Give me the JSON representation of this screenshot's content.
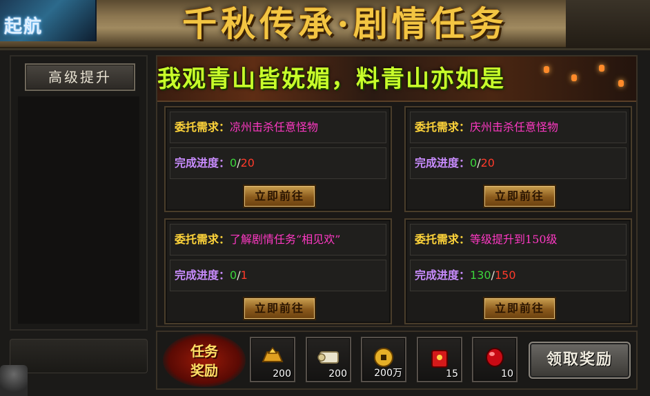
{
  "header": {
    "logo_text": "起航",
    "title": "千秋传承·剧情任务"
  },
  "sidebar": {
    "tab_label": "高级提升"
  },
  "banner": {
    "poem": "我观青山皆妩媚，料青山亦如是"
  },
  "labels": {
    "requirement": "委托需求：",
    "progress": "完成进度：",
    "go_button": "立即前往",
    "progress_sep": "/"
  },
  "tasks": [
    {
      "requirement": "凉州击杀任意怪物",
      "current": "0",
      "max": "20"
    },
    {
      "requirement": "庆州击杀任意怪物",
      "current": "0",
      "max": "20"
    },
    {
      "requirement": "了解剧情任务“相见欢”",
      "current": "0",
      "max": "1"
    },
    {
      "requirement": "等级提升到150级",
      "current": "130",
      "max": "150"
    }
  ],
  "rewards": {
    "badge_line1": "任务",
    "badge_line2": "奖励",
    "items": [
      {
        "icon": "gold-ingot-icon",
        "qty": "200"
      },
      {
        "icon": "scroll-icon",
        "qty": "200"
      },
      {
        "icon": "gold-coin-icon",
        "qty": "200万"
      },
      {
        "icon": "red-envelope-icon",
        "qty": "15"
      },
      {
        "icon": "red-gem-icon",
        "qty": "10"
      }
    ],
    "claim_label": "领取奖励"
  },
  "colors": {
    "requirement_label": "#ffd43a",
    "progress_label": "#c98cff",
    "requirement_text": "#ff39c4",
    "progress_current": "#3cd63c",
    "progress_max": "#ff3a2a",
    "poem": "#c8ff2a",
    "title": "#f3c542"
  }
}
